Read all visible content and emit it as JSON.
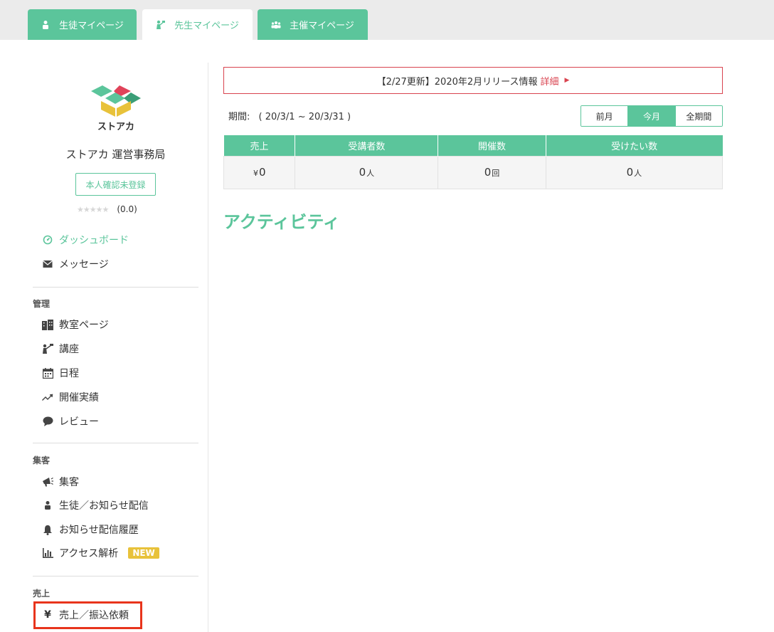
{
  "tabs": [
    {
      "label": "生徒マイページ",
      "icon": "student-icon"
    },
    {
      "label": "先生マイページ",
      "icon": "teacher-icon"
    },
    {
      "label": "主催マイページ",
      "icon": "group-icon"
    }
  ],
  "profile": {
    "logo_text": "ストアカ",
    "name": "ストアカ 運営事務局",
    "verify_button": "本人確認未登録",
    "stars": "★★★★★",
    "rating": "(0.0)"
  },
  "nav": {
    "dashboard": "ダッシュボード",
    "messages": "メッセージ",
    "section_manage": "管理",
    "classroom": "教室ページ",
    "courses": "講座",
    "schedule": "日程",
    "results": "開催実績",
    "reviews": "レビュー",
    "section_marketing": "集客",
    "marketing": "集客",
    "notify": "生徒／お知らせ配信",
    "notify_history": "お知らせ配信履歴",
    "analytics": "アクセス解析",
    "new_badge": "NEW",
    "section_sales": "売上",
    "sales_transfer": "売上／振込依頼",
    "yen_symbol": "¥"
  },
  "notice": {
    "text": "【2/27更新】2020年2月リリース情報",
    "detail": "詳細",
    "arrow": "▶"
  },
  "period": {
    "label": "期間:",
    "range": "( 20/3/1 ~ 20/3/31 )"
  },
  "period_buttons": [
    "前月",
    "今月",
    "全期間"
  ],
  "period_selected": "今月",
  "stats": {
    "headers": [
      "売上",
      "受講者数",
      "開催数",
      "受けたい数"
    ],
    "sales_prefix": "¥",
    "sales": "0",
    "students": "0",
    "students_unit": "人",
    "events": "0",
    "events_unit": "回",
    "wants": "0",
    "wants_unit": "人"
  },
  "activity_title": "アクティビティ",
  "colors": {
    "accent": "#5bc59b",
    "alert": "#d9434f",
    "badge": "#e8c23a",
    "highlight": "#e8341c"
  }
}
